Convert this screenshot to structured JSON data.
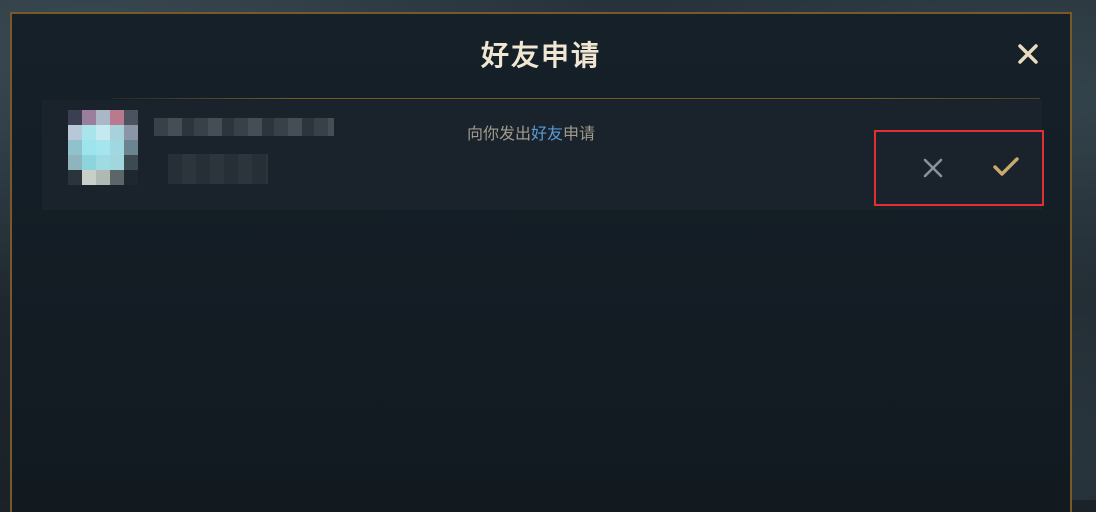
{
  "dialog": {
    "title": "好友申请",
    "close_icon": "close-icon"
  },
  "request": {
    "message_prefix": "向你发出",
    "message_highlight": "好友",
    "message_suffix": "申请",
    "decline_icon": "x-icon",
    "accept_icon": "check-icon"
  },
  "colors": {
    "gold": "#c8aa6e",
    "gold_border": "#785a28",
    "title_text": "#f0e6d2",
    "highlight_blue": "#5b9bd5",
    "decline_grey": "#8a9299",
    "annotation_red": "#e03131"
  }
}
